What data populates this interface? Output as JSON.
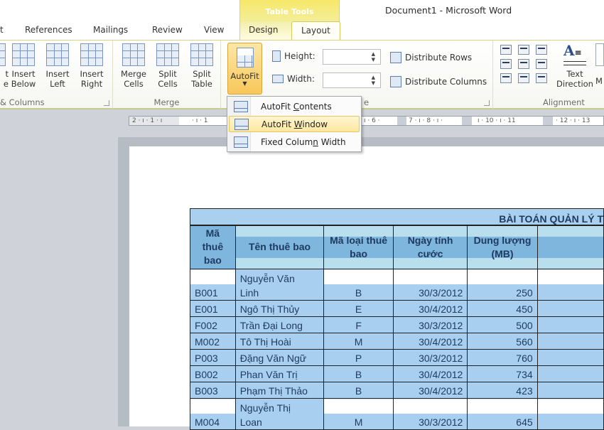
{
  "window": {
    "title": "Document1  -  Microsoft Word"
  },
  "ribbon_tabs": [
    {
      "label": "t"
    },
    {
      "label": "References"
    },
    {
      "label": "Mailings"
    },
    {
      "label": "Review"
    },
    {
      "label": "View"
    },
    {
      "label": "Design"
    },
    {
      "label": "Layout",
      "active": true
    }
  ],
  "context_group": {
    "label": "Table Tools"
  },
  "groups": {
    "rows_columns": {
      "label": "& Columns",
      "buttons": [
        {
          "line1": "t",
          "line2": "e"
        },
        {
          "line1": "Insert",
          "line2": "Below"
        },
        {
          "line1": "Insert",
          "line2": "Left"
        },
        {
          "line1": "Insert",
          "line2": "Right"
        }
      ]
    },
    "merge": {
      "label": "Merge",
      "buttons": [
        {
          "line1": "Merge",
          "line2": "Cells"
        },
        {
          "line1": "Split",
          "line2": "Cells"
        },
        {
          "line1": "Split",
          "line2": "Table"
        }
      ]
    },
    "cell_size": {
      "label_fragment": "e",
      "autofit_label": "AutoFit",
      "height_label": "Height:",
      "height_value": "",
      "width_label": "Width:",
      "width_value": "",
      "distribute_rows": "Distribute Rows",
      "distribute_columns": "Distribute Columns"
    },
    "alignment": {
      "label": "Alignment",
      "text_direction_line1": "Text",
      "text_direction_line2": "Direction",
      "cut_off": "M"
    }
  },
  "autofit_menu": {
    "items": [
      {
        "pre": "AutoFit ",
        "accel": "C",
        "post": "ontents"
      },
      {
        "pre": "AutoFit ",
        "accel": "W",
        "post": "indow",
        "highlighted": true
      },
      {
        "pre": "Fixed Colum",
        "accel": "n",
        "post": " Width"
      }
    ]
  },
  "ruler": {
    "left_text": "2 · ı · 1 · ı",
    "mid_text": "· ı · 1",
    "right_segments": [
      "ı · 6 ·",
      "7 · ı · 8 · ı ·",
      "ı · 10 · ı · 11",
      "· 12 · ı · 13"
    ]
  },
  "table": {
    "title": "BÀI TOÁN QUẢN LÝ T",
    "headers": [
      "Mã thuê bao",
      "Tên thuê bao",
      "Mã loại thuê bao",
      "Ngày tính cước",
      "Dung lượng (MB)",
      ""
    ],
    "rows": [
      {
        "id": "B001",
        "name_line1": "Nguyễn Văn",
        "name_line2": "Linh",
        "type": "B",
        "date": "30/3/2012",
        "mb": "250"
      },
      {
        "id": "E001",
        "name": "Ngô Thị Thủy",
        "type": "E",
        "date": "30/4/2012",
        "mb": "450"
      },
      {
        "id": "F002",
        "name": "Trần Đại Long",
        "type": "F",
        "date": "30/3/2012",
        "mb": "500"
      },
      {
        "id": "M002",
        "name": "Tô Thị Hoài",
        "type": "M",
        "date": "30/4/2012",
        "mb": "560"
      },
      {
        "id": "P003",
        "name": "Đặng Văn Ngữ",
        "type": "P",
        "date": "30/3/2012",
        "mb": "760"
      },
      {
        "id": "B002",
        "name": "Phan Văn Trị",
        "type": "B",
        "date": "30/4/2012",
        "mb": "734"
      },
      {
        "id": "B003",
        "name": "Phạm Thị Thảo",
        "type": "B",
        "date": "30/4/2012",
        "mb": "423"
      },
      {
        "id": "M004",
        "name_line1": "Nguyễn Thị",
        "name_line2": "Loan",
        "type": "M",
        "date": "30/3/2012",
        "mb": "645"
      }
    ]
  }
}
